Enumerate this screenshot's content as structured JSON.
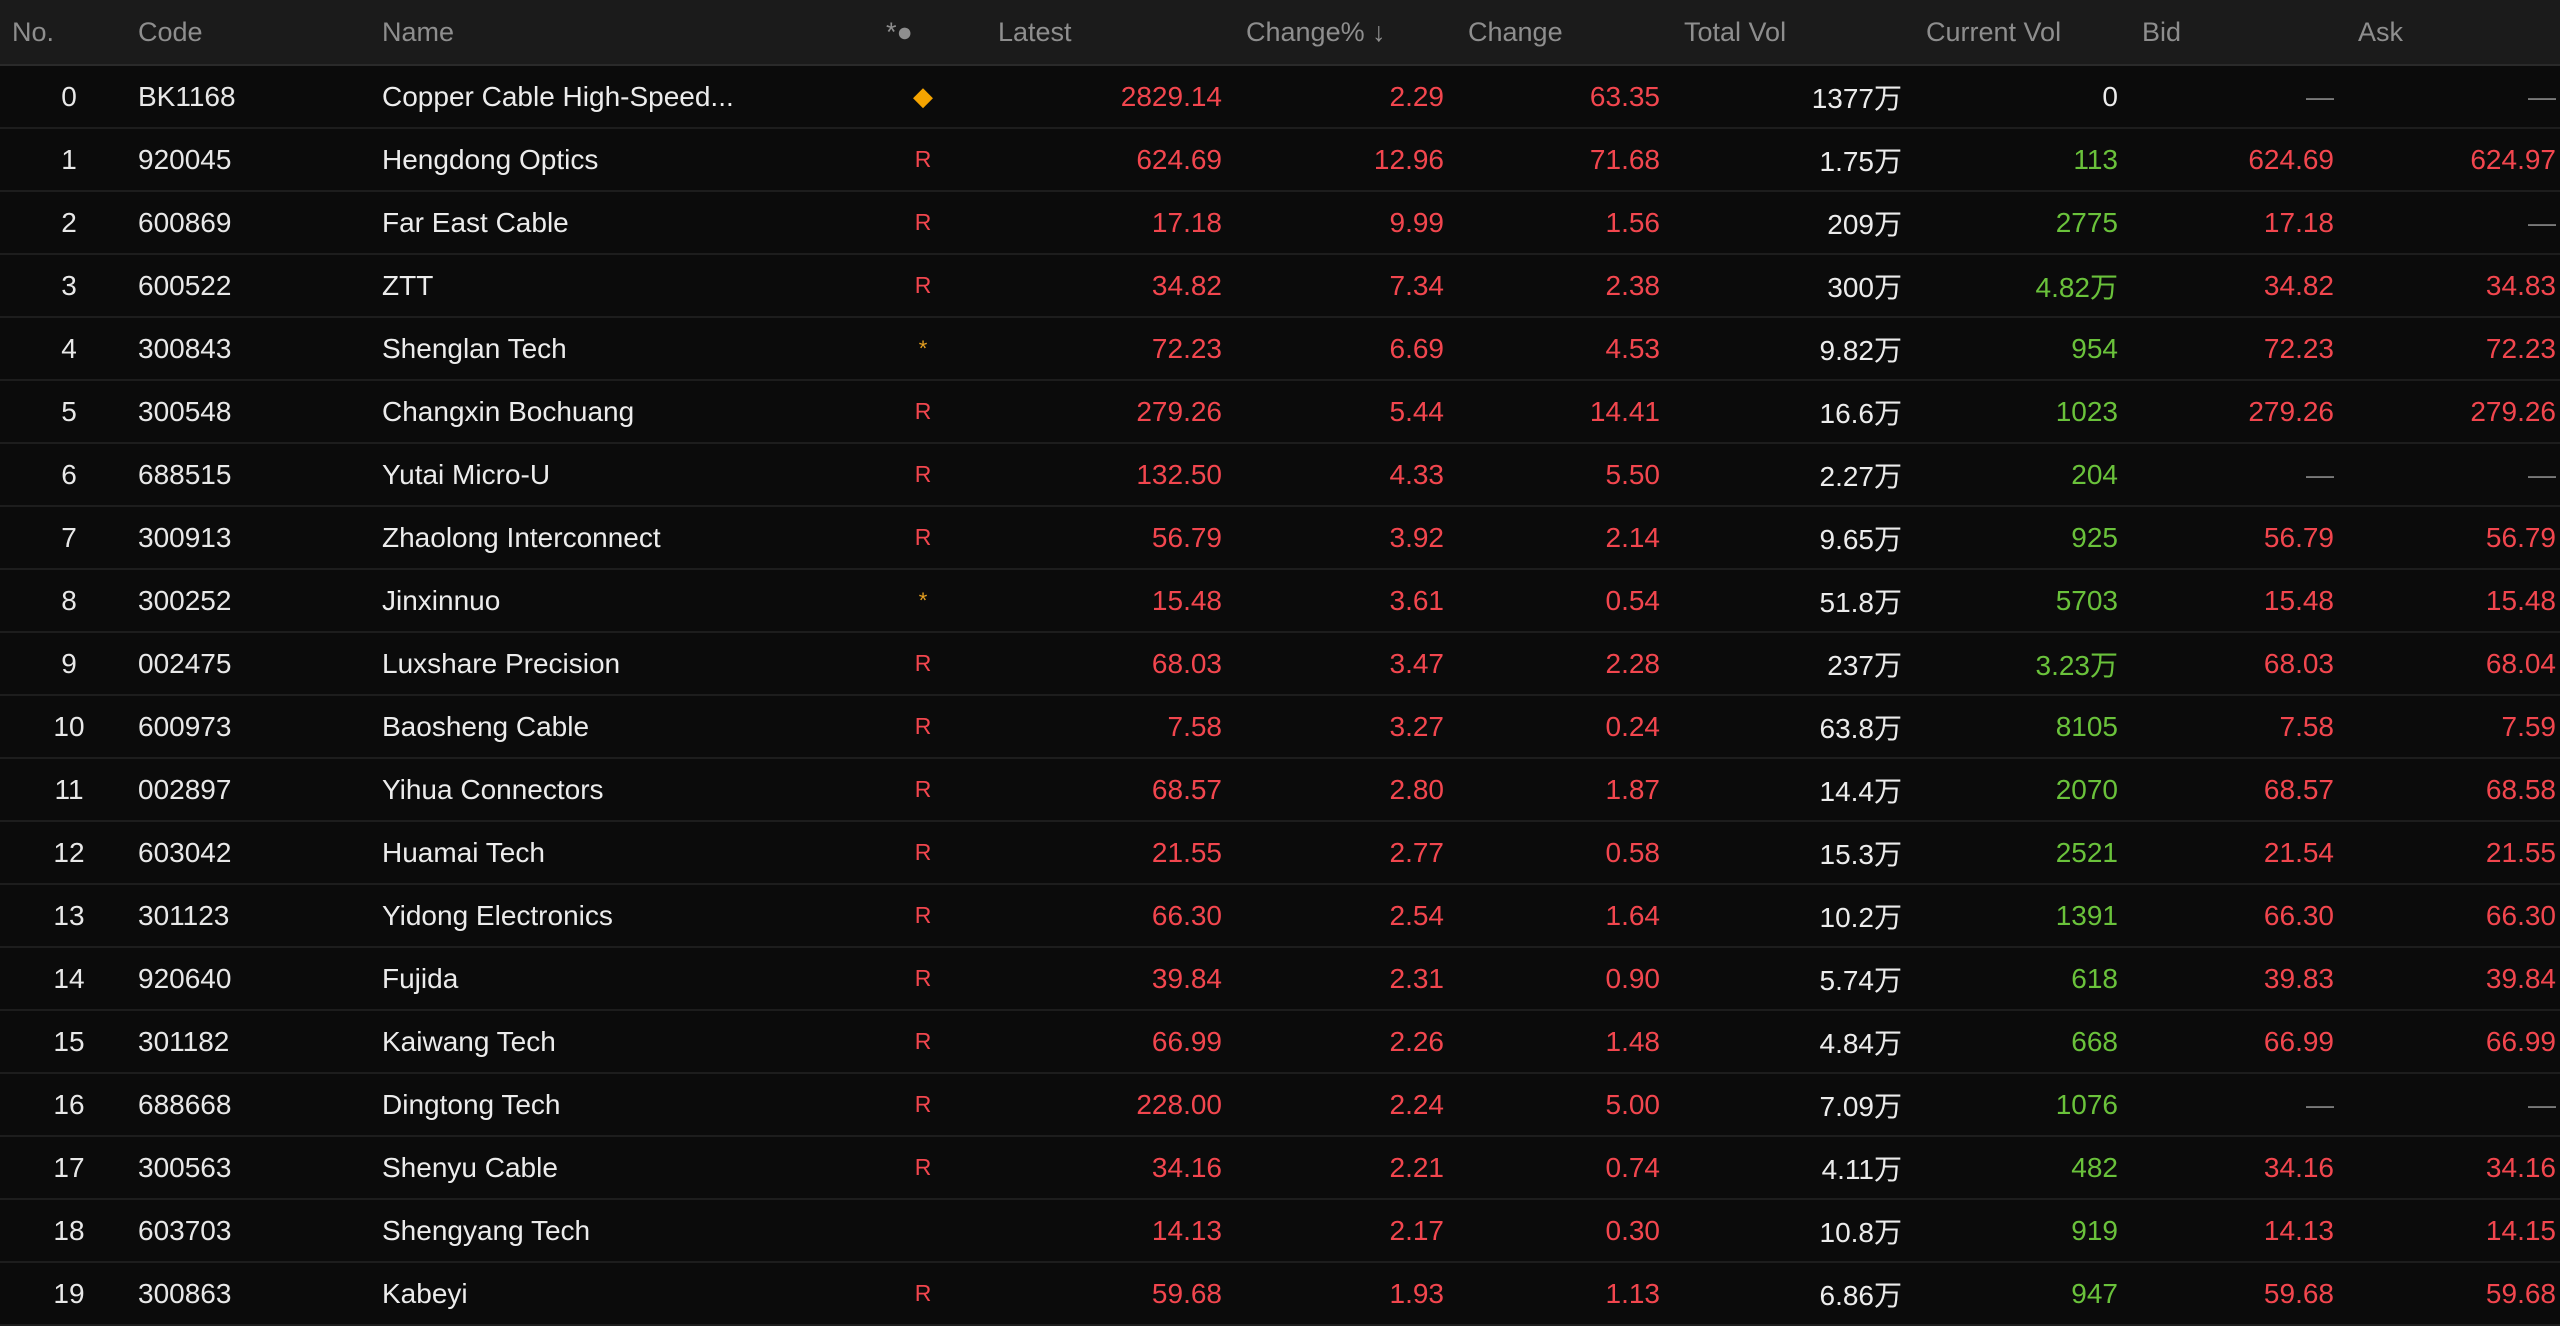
{
  "headers": {
    "no": "No.",
    "code": "Code",
    "name": "Name",
    "flag": "*●",
    "latest": "Latest",
    "change_pct": "Change% ↓",
    "change": "Change",
    "total_vol": "Total Vol",
    "current_vol": "Current Vol",
    "bid": "Bid",
    "ask": "Ask"
  },
  "colors": {
    "up": "#f2464e",
    "vol": "#6ac23b",
    "neutral": "#ececec",
    "header_bg": "#1b1b1b",
    "row_bg": "#0b0b0b"
  },
  "rows": [
    {
      "no": "0",
      "code": "BK1168",
      "name": "Copper Cable High-Speed...",
      "flag": "◆",
      "flag_icon": "diamond-icon",
      "latest": "2829.14",
      "change_pct": "2.29",
      "change": "63.35",
      "total_vol": "1377万",
      "current_vol": "0",
      "current_vol_color": "white",
      "bid": "—",
      "ask": "—"
    },
    {
      "no": "1",
      "code": "920045",
      "name": "Hengdong Optics",
      "flag": "R",
      "flag_icon": "r-badge",
      "latest": "624.69",
      "change_pct": "12.96",
      "change": "71.68",
      "total_vol": "1.75万",
      "current_vol": "113",
      "current_vol_color": "green",
      "bid": "624.69",
      "ask": "624.97"
    },
    {
      "no": "2",
      "code": "600869",
      "name": "Far East Cable",
      "flag": "R",
      "flag_icon": "r-badge",
      "latest": "17.18",
      "change_pct": "9.99",
      "change": "1.56",
      "total_vol": "209万",
      "current_vol": "2775",
      "current_vol_color": "green",
      "bid": "17.18",
      "ask": "—"
    },
    {
      "no": "3",
      "code": "600522",
      "name": "ZTT",
      "flag": "R",
      "flag_icon": "r-badge",
      "latest": "34.82",
      "change_pct": "7.34",
      "change": "2.38",
      "total_vol": "300万",
      "current_vol": "4.82万",
      "current_vol_color": "green",
      "bid": "34.82",
      "ask": "34.83"
    },
    {
      "no": "4",
      "code": "300843",
      "name": "Shenglan Tech",
      "flag": "*",
      "flag_icon": "star-icon",
      "latest": "72.23",
      "change_pct": "6.69",
      "change": "4.53",
      "total_vol": "9.82万",
      "current_vol": "954",
      "current_vol_color": "green",
      "bid": "72.23",
      "ask": "72.23"
    },
    {
      "no": "5",
      "code": "300548",
      "name": "Changxin Bochuang",
      "flag": "R",
      "flag_icon": "r-badge",
      "latest": "279.26",
      "change_pct": "5.44",
      "change": "14.41",
      "total_vol": "16.6万",
      "current_vol": "1023",
      "current_vol_color": "green",
      "bid": "279.26",
      "ask": "279.26"
    },
    {
      "no": "6",
      "code": "688515",
      "name": "Yutai Micro-U",
      "flag": "R",
      "flag_icon": "r-badge",
      "latest": "132.50",
      "change_pct": "4.33",
      "change": "5.50",
      "total_vol": "2.27万",
      "current_vol": "204",
      "current_vol_color": "green",
      "bid": "—",
      "ask": "—"
    },
    {
      "no": "7",
      "code": "300913",
      "name": "Zhaolong Interconnect",
      "flag": "R",
      "flag_icon": "r-badge",
      "latest": "56.79",
      "change_pct": "3.92",
      "change": "2.14",
      "total_vol": "9.65万",
      "current_vol": "925",
      "current_vol_color": "green",
      "bid": "56.79",
      "ask": "56.79"
    },
    {
      "no": "8",
      "code": "300252",
      "name": "Jinxinnuo",
      "flag": "*",
      "flag_icon": "star-icon",
      "latest": "15.48",
      "change_pct": "3.61",
      "change": "0.54",
      "total_vol": "51.8万",
      "current_vol": "5703",
      "current_vol_color": "green",
      "bid": "15.48",
      "ask": "15.48"
    },
    {
      "no": "9",
      "code": "002475",
      "name": "Luxshare Precision",
      "flag": "R",
      "flag_icon": "r-badge",
      "latest": "68.03",
      "change_pct": "3.47",
      "change": "2.28",
      "total_vol": "237万",
      "current_vol": "3.23万",
      "current_vol_color": "green",
      "bid": "68.03",
      "ask": "68.04"
    },
    {
      "no": "10",
      "code": "600973",
      "name": "Baosheng Cable",
      "flag": "R",
      "flag_icon": "r-badge",
      "latest": "7.58",
      "change_pct": "3.27",
      "change": "0.24",
      "total_vol": "63.8万",
      "current_vol": "8105",
      "current_vol_color": "green",
      "bid": "7.58",
      "ask": "7.59"
    },
    {
      "no": "11",
      "code": "002897",
      "name": "Yihua Connectors",
      "flag": "R",
      "flag_icon": "r-badge",
      "latest": "68.57",
      "change_pct": "2.80",
      "change": "1.87",
      "total_vol": "14.4万",
      "current_vol": "2070",
      "current_vol_color": "green",
      "bid": "68.57",
      "ask": "68.58"
    },
    {
      "no": "12",
      "code": "603042",
      "name": "Huamai Tech",
      "flag": "R",
      "flag_icon": "r-badge",
      "latest": "21.55",
      "change_pct": "2.77",
      "change": "0.58",
      "total_vol": "15.3万",
      "current_vol": "2521",
      "current_vol_color": "green",
      "bid": "21.54",
      "ask": "21.55"
    },
    {
      "no": "13",
      "code": "301123",
      "name": "Yidong Electronics",
      "flag": "R",
      "flag_icon": "r-badge",
      "latest": "66.30",
      "change_pct": "2.54",
      "change": "1.64",
      "total_vol": "10.2万",
      "current_vol": "1391",
      "current_vol_color": "green",
      "bid": "66.30",
      "ask": "66.30"
    },
    {
      "no": "14",
      "code": "920640",
      "name": "Fujida",
      "flag": "R",
      "flag_icon": "r-badge",
      "latest": "39.84",
      "change_pct": "2.31",
      "change": "0.90",
      "total_vol": "5.74万",
      "current_vol": "618",
      "current_vol_color": "green",
      "bid": "39.83",
      "ask": "39.84"
    },
    {
      "no": "15",
      "code": "301182",
      "name": "Kaiwang Tech",
      "flag": "R",
      "flag_icon": "r-badge",
      "latest": "66.99",
      "change_pct": "2.26",
      "change": "1.48",
      "total_vol": "4.84万",
      "current_vol": "668",
      "current_vol_color": "green",
      "bid": "66.99",
      "ask": "66.99"
    },
    {
      "no": "16",
      "code": "688668",
      "name": "Dingtong Tech",
      "flag": "R",
      "flag_icon": "r-badge",
      "latest": "228.00",
      "change_pct": "2.24",
      "change": "5.00",
      "total_vol": "7.09万",
      "current_vol": "1076",
      "current_vol_color": "green",
      "bid": "—",
      "ask": "—"
    },
    {
      "no": "17",
      "code": "300563",
      "name": "Shenyu Cable",
      "flag": "R",
      "flag_icon": "r-badge",
      "latest": "34.16",
      "change_pct": "2.21",
      "change": "0.74",
      "total_vol": "4.11万",
      "current_vol": "482",
      "current_vol_color": "green",
      "bid": "34.16",
      "ask": "34.16"
    },
    {
      "no": "18",
      "code": "603703",
      "name": "Shengyang Tech",
      "flag": "",
      "flag_icon": "",
      "latest": "14.13",
      "change_pct": "2.17",
      "change": "0.30",
      "total_vol": "10.8万",
      "current_vol": "919",
      "current_vol_color": "green",
      "bid": "14.13",
      "ask": "14.15"
    },
    {
      "no": "19",
      "code": "300863",
      "name": "Kabeyi",
      "flag": "R",
      "flag_icon": "r-badge",
      "latest": "59.68",
      "change_pct": "1.93",
      "change": "1.13",
      "total_vol": "6.86万",
      "current_vol": "947",
      "current_vol_color": "green",
      "bid": "59.68",
      "ask": "59.68"
    }
  ]
}
